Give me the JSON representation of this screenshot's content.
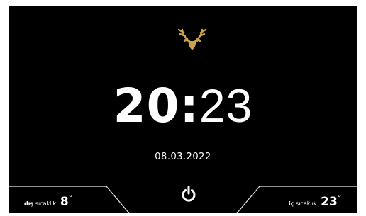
{
  "colors": {
    "background": "#000000",
    "text": "#ffffff",
    "logo_gold": "#c9a24a",
    "lines": "#e6e6e6"
  },
  "logo": {
    "icon": "deer-antlers-logo"
  },
  "clock": {
    "hours": "20",
    "colon": ":",
    "minutes": "23"
  },
  "date": "08.03.2022",
  "outdoor": {
    "label_bold": "dış",
    "label": " sıcaklık:",
    "value": "8",
    "unit": "°"
  },
  "indoor": {
    "label_bold": "iç",
    "label": " sıcaklık:",
    "value": "23",
    "unit": "°"
  },
  "power_button": {
    "icon": "power-icon"
  }
}
